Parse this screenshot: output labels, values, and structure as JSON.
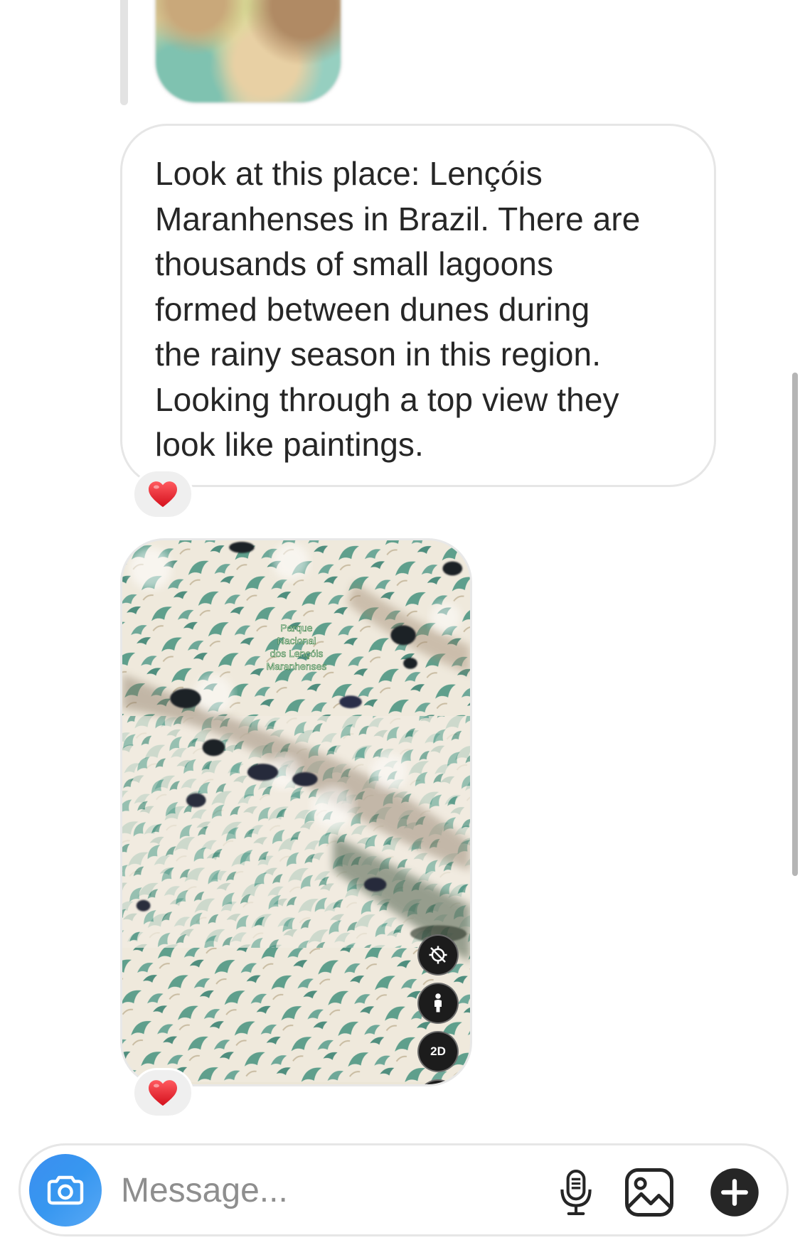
{
  "conversation": {
    "messages": [
      {
        "type": "text",
        "text": "Look at this place: Lençóis\nMaranhenses in Brazil.  There are\nthousands of small lagoons\nformed between dunes during\nthe rainy season in this region.\nLooking through a top view they\nlook like paintings.",
        "reaction": "heart"
      },
      {
        "type": "image",
        "description_icon": "satellite-map",
        "map_label": "Parque\nNacional\ndos Lençóis\nMaranhenses",
        "map_controls": {
          "compass_icon": "compass-disabled-icon",
          "person_icon": "pegman-icon",
          "view_mode_label": "2D"
        },
        "reaction": "heart"
      }
    ]
  },
  "composer": {
    "placeholder": "Message...",
    "camera_icon": "camera-icon",
    "mic_icon": "microphone-icon",
    "gallery_icon": "gallery-icon",
    "plus_icon": "plus-icon"
  },
  "colors": {
    "accent_blue": "#3797f0",
    "reaction_heart": "#e0202b",
    "bubble_border": "#e6e6e6",
    "text": "#262626",
    "placeholder": "#8e8e8e"
  }
}
